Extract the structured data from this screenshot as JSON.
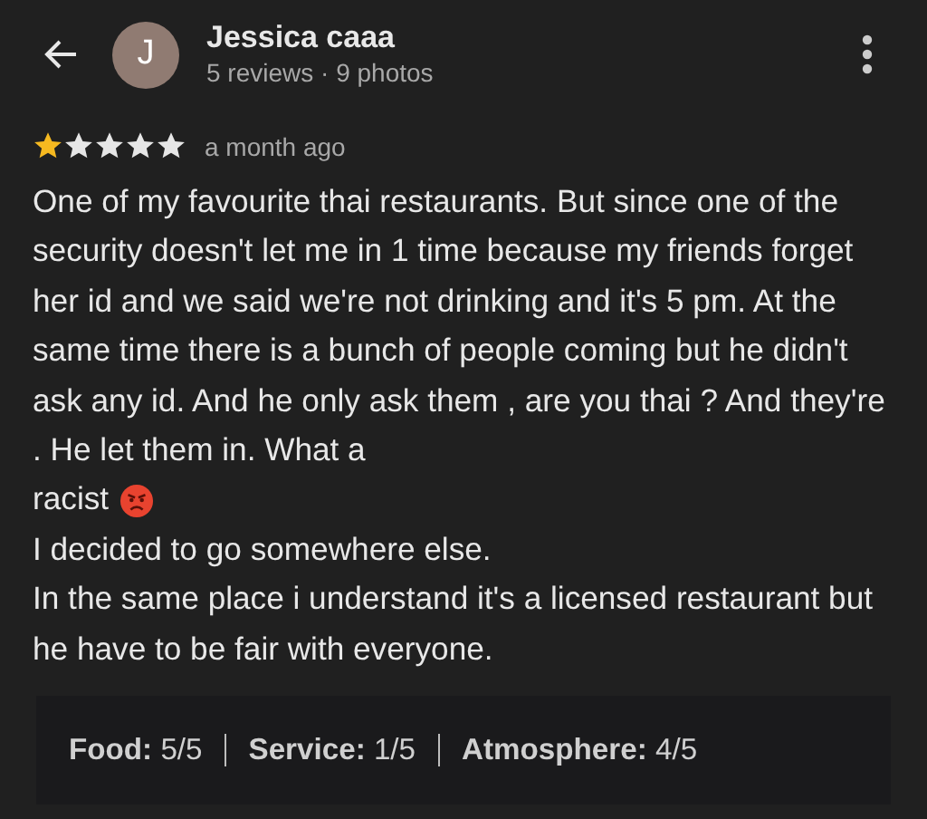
{
  "header": {
    "avatar_letter": "J",
    "name": "Jessica caaa",
    "meta": "5 reviews · 9 photos"
  },
  "review": {
    "stars": 1,
    "time": "a month ago",
    "paragraphs": [
      {
        "text": "One of my favourite thai restaurants. But since one of the security doesn't let me in 1 time because my friends forget her id and we said we're not drinking and it's 5 pm. At the same time there is a bunch of people coming but he didn't ask any id. And he only ask them , are you thai ? And they're . He let them in. What a",
        "emoji": false
      },
      {
        "text": "racist",
        "emoji": true
      },
      {
        "text": "I decided to go somewhere else.",
        "emoji": false
      },
      {
        "text": "In the same place i understand it's a licensed restaurant but he have to be fair with everyone.",
        "emoji": false
      }
    ]
  },
  "ratings": [
    {
      "label": "Food:",
      "value": "5/5"
    },
    {
      "label": "Service:",
      "value": "1/5"
    },
    {
      "label": "Atmosphere:",
      "value": "4/5"
    }
  ]
}
